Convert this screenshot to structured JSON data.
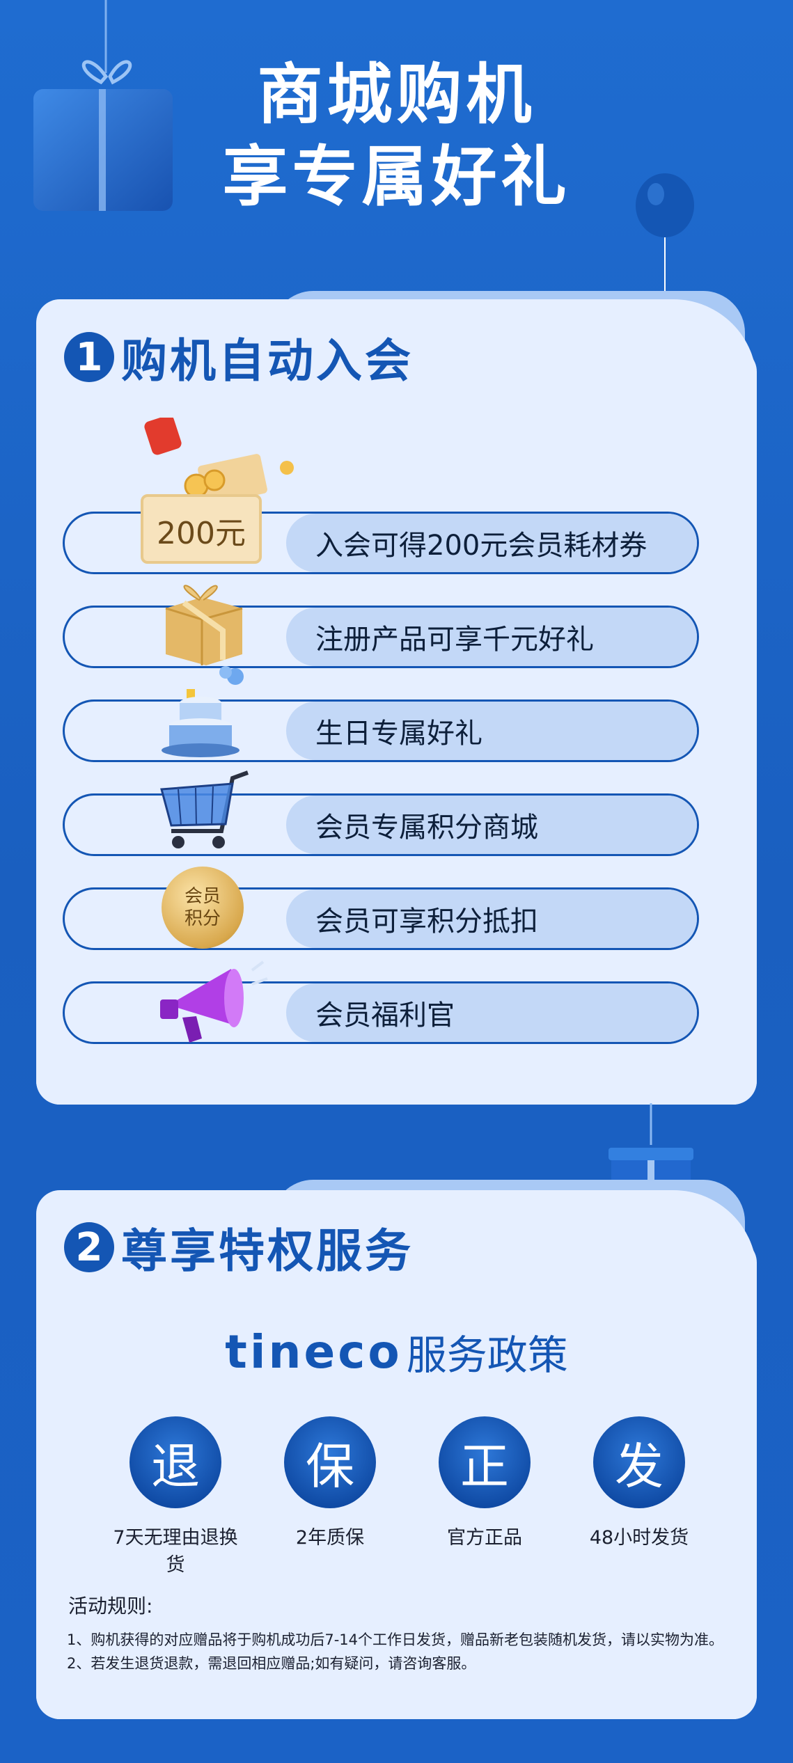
{
  "hero": {
    "title_line1": "商城购机",
    "title_line2": "享专属好礼"
  },
  "section1": {
    "number": "1",
    "title": "购机自动入会",
    "coupon_amount": "200元",
    "items": [
      {
        "label": "入会可得200元会员耗材券",
        "icon": "coupon-icon"
      },
      {
        "label": "注册产品可享千元好礼",
        "icon": "gift-box-icon"
      },
      {
        "label": "生日专属好礼",
        "icon": "birthday-cake-icon"
      },
      {
        "label": "会员专属积分商城",
        "icon": "shopping-cart-icon"
      },
      {
        "label": "会员可享积分抵扣",
        "icon": "points-coin-icon"
      },
      {
        "label": "会员福利官",
        "icon": "megaphone-icon"
      }
    ],
    "coin_text_line1": "会员",
    "coin_text_line2": "积分"
  },
  "section2": {
    "number": "2",
    "title": "尊享特权服务",
    "brand": "tineco",
    "policy_label": "服务政策",
    "services": [
      {
        "glyph": "退",
        "label": "7天无理由退换货"
      },
      {
        "glyph": "保",
        "label": "2年质保"
      },
      {
        "glyph": "正",
        "label": "官方正品"
      },
      {
        "glyph": "发",
        "label": "48小时发货"
      }
    ],
    "rules_title": "活动规则:",
    "rules": [
      "1、购机获得的对应赠品将于购机成功后7-14个工作日发货，赠品新老包装随机发货，请以实物为准。",
      "2、若发生退货退款，需退回相应赠品;如有疑问，请咨询客服。"
    ]
  },
  "colors": {
    "background": "#1b63c4",
    "card": "#e6efff",
    "accent": "#1456b4",
    "pill": "#c3d8f7"
  }
}
